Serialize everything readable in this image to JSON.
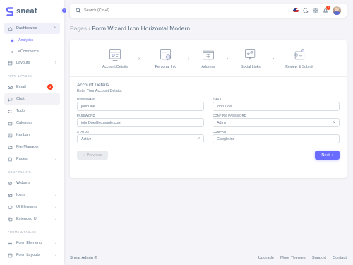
{
  "brand": {
    "name": "sneat"
  },
  "sidebar": {
    "items": [
      {
        "label": "Dashboards",
        "type": "item",
        "icon": "home-icon",
        "chevron": "˅",
        "state": "open"
      },
      {
        "label": "Analytics",
        "type": "sub",
        "active": true
      },
      {
        "label": "eCommerce",
        "type": "sub",
        "active": false
      },
      {
        "label": "Layouts",
        "type": "item",
        "icon": "layout-icon",
        "chevron": "›"
      },
      {
        "label": "APPS & PAGES",
        "type": "header"
      },
      {
        "label": "Email",
        "type": "item",
        "icon": "mail-icon",
        "badge": "3"
      },
      {
        "label": "Chat",
        "type": "item",
        "icon": "chat-icon",
        "state": "hover"
      },
      {
        "label": "Todo",
        "type": "item",
        "icon": "checklist-icon"
      },
      {
        "label": "Calendar",
        "type": "item",
        "icon": "calendar-icon"
      },
      {
        "label": "Kanban",
        "type": "item",
        "icon": "kanban-icon"
      },
      {
        "label": "File Manager",
        "type": "item",
        "icon": "folder-icon"
      },
      {
        "label": "Pages",
        "type": "item",
        "icon": "file-icon",
        "chevron": "›"
      },
      {
        "label": "COMPONENTS",
        "type": "header"
      },
      {
        "label": "Widgets",
        "type": "item",
        "icon": "widget-icon"
      },
      {
        "label": "Icons",
        "type": "item",
        "icon": "crown-icon",
        "chevron": "›"
      },
      {
        "label": "UI Elements",
        "type": "item",
        "icon": "box-icon",
        "chevron": "›"
      },
      {
        "label": "Extended UI",
        "type": "item",
        "icon": "copy-icon",
        "chevron": "›"
      },
      {
        "label": "FORMS & TABLES",
        "type": "header"
      },
      {
        "label": "Form Elements",
        "type": "item",
        "icon": "list-icon",
        "chevron": "›"
      },
      {
        "label": "Form Layouts",
        "type": "item",
        "icon": "layout-icon",
        "chevron": "›"
      }
    ]
  },
  "topbar": {
    "search_placeholder": "Search (Ctrl+/)",
    "notification_count": "4"
  },
  "page": {
    "breadcrumb_parent": "Pages /",
    "title": "Form Wizard Icon Horizontal Modern"
  },
  "wizard": {
    "steps": [
      {
        "label": "Account Details",
        "icon": "account-details-icon",
        "active": false
      },
      {
        "label": "Personal Info",
        "icon": "personal-info-icon",
        "active": true
      },
      {
        "label": "Address",
        "icon": "address-icon",
        "active": false
      },
      {
        "label": "Social Links",
        "icon": "social-links-icon",
        "active": false
      },
      {
        "label": "Review & Submit",
        "icon": "review-submit-icon",
        "active": false
      }
    ],
    "section_title": "Account Details",
    "section_subtitle": "Enter Your Account Details.",
    "fields": {
      "username": {
        "label": "USERNAME",
        "value": "johnDoe"
      },
      "email": {
        "label": "EMAIL",
        "value": "john.Doe"
      },
      "password": {
        "label": "PASSWORD",
        "value": "johnDoe@example.com"
      },
      "confirm_password": {
        "label": "CONFIRM PASSWORD",
        "value": "Admin"
      },
      "status": {
        "label": "STATUS",
        "value": "Active"
      },
      "company": {
        "label": "COMPANY",
        "value": "Google.inc"
      }
    },
    "prev_label": "Previous",
    "next_label": "Next"
  },
  "footer": {
    "brand": "Sneat Admin ©",
    "links": [
      "Upgrade",
      "More Themes",
      "Support",
      "Contact"
    ]
  },
  "colors": {
    "primary": "#696cff",
    "danger": "#ff3e1d",
    "background": "#f5f5f9"
  }
}
